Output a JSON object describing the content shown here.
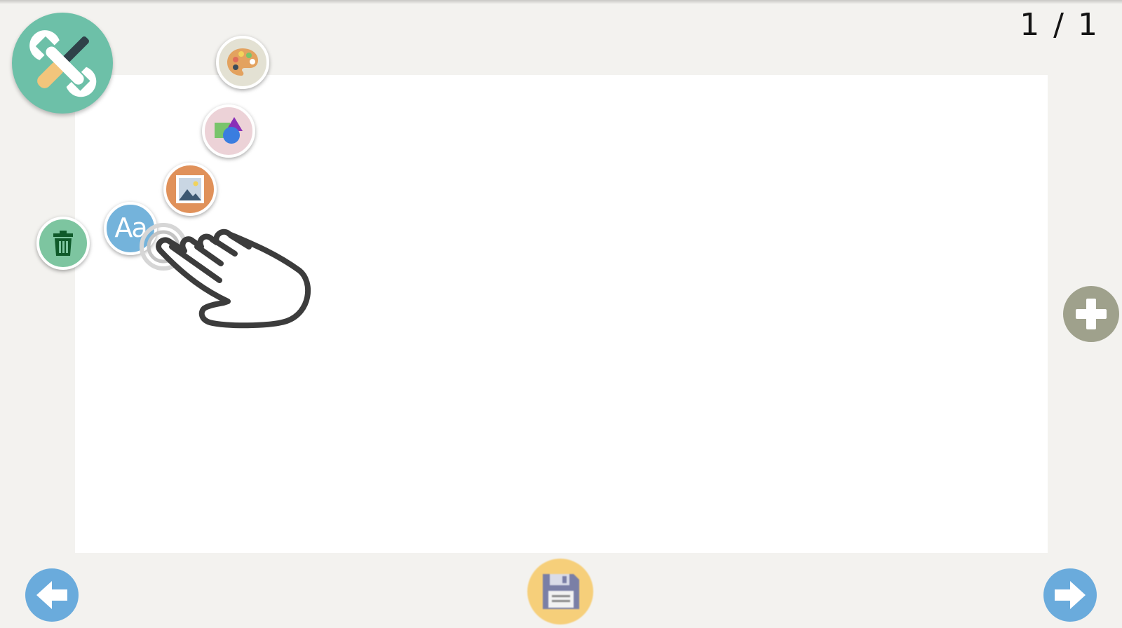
{
  "page_counter": {
    "current": "1",
    "separator": "/",
    "total": "1",
    "text": "1 / 1"
  },
  "tool_menu": {
    "toggle_icon": "tools-icon",
    "items": [
      {
        "name": "palette",
        "icon": "palette-icon",
        "color": "#e3e1d3"
      },
      {
        "name": "shapes",
        "icon": "shapes-icon",
        "color": "#ecd2d7"
      },
      {
        "name": "image",
        "icon": "image-icon",
        "color": "#e0915a"
      },
      {
        "name": "text",
        "icon": "text-icon",
        "label": "Aa",
        "color": "#74b3db"
      },
      {
        "name": "delete",
        "icon": "trash-icon",
        "color": "#7dc5a0"
      }
    ]
  },
  "tutorial_hint": {
    "icon": "tap-hand-icon"
  },
  "footer": {
    "prev_icon": "arrow-left-icon",
    "save_icon": "floppy-disk-icon",
    "next_icon": "arrow-right-icon"
  },
  "add_page_icon": "plus-icon",
  "colors": {
    "background": "#f3f2ef",
    "canvas": "#ffffff",
    "tools_accent": "#6dc0a8",
    "nav_blue": "#6aabdc",
    "save_yellow": "#f6cf7a",
    "add_gray": "#9fa18c"
  }
}
